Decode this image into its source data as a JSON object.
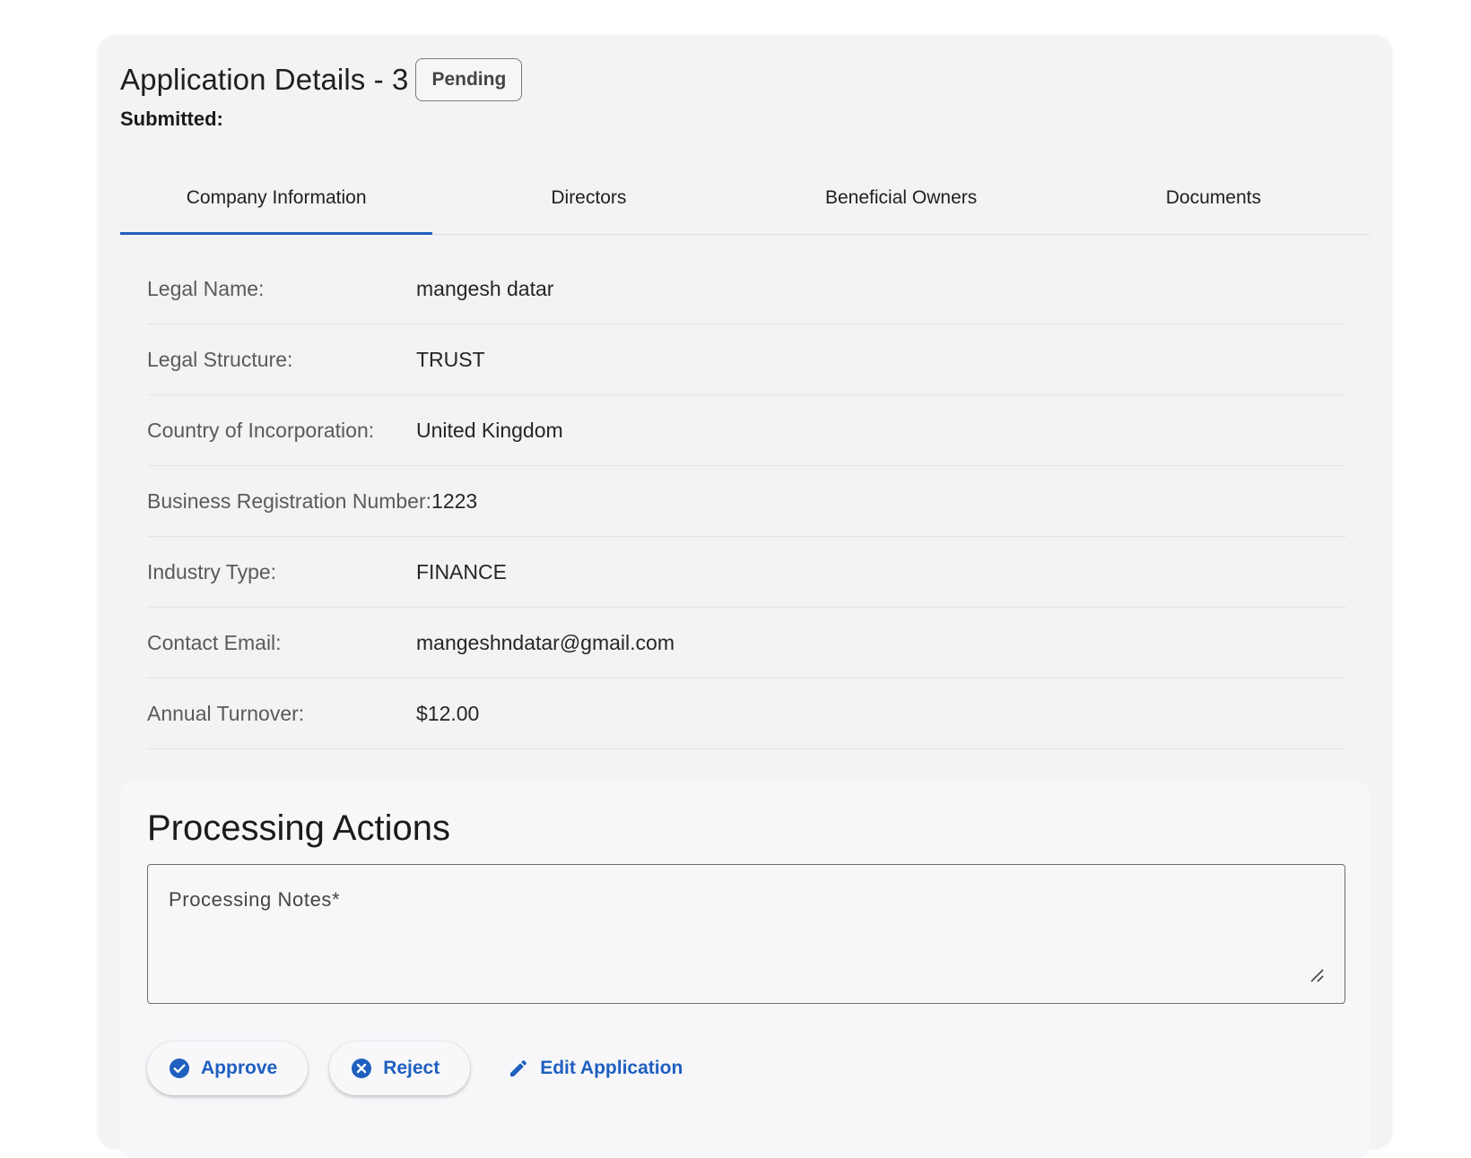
{
  "header": {
    "title": "Application Details - 3",
    "status": "Pending",
    "submitted_label": "Submitted:"
  },
  "tabs": [
    {
      "label": "Company Information",
      "active": true
    },
    {
      "label": "Directors",
      "active": false
    },
    {
      "label": "Beneficial Owners",
      "active": false
    },
    {
      "label": "Documents",
      "active": false
    }
  ],
  "company_info": [
    {
      "label": "Legal Name:",
      "value": "mangesh datar"
    },
    {
      "label": "Legal Structure:",
      "value": "TRUST"
    },
    {
      "label": "Country of Incorporation:",
      "value": "United Kingdom"
    },
    {
      "label": "Business Registration Number:",
      "value": "1223"
    },
    {
      "label": "Industry Type:",
      "value": "FINANCE"
    },
    {
      "label": "Contact Email:",
      "value": "mangeshndatar@gmail.com"
    },
    {
      "label": "Annual Turnover:",
      "value": "$12.00"
    }
  ],
  "actions": {
    "title": "Processing Actions",
    "notes_placeholder": "Processing Notes*",
    "notes_value": "",
    "approve_label": "Approve",
    "reject_label": "Reject",
    "edit_label": "Edit Application"
  },
  "colors": {
    "accent": "#1f5fbf",
    "card_bg": "#f3f3f5",
    "panel_bg": "#f7f7fa"
  },
  "icons": {
    "approve": "check-circle-icon",
    "reject": "x-circle-icon",
    "edit": "pencil-icon",
    "resize": "resize-handle-icon"
  }
}
